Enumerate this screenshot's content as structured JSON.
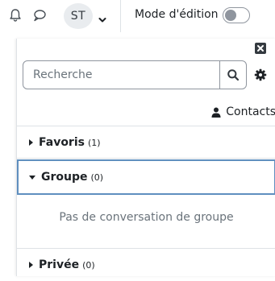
{
  "navbar": {
    "avatar_initials": "ST",
    "edit_mode_label": "Mode d'édition",
    "edit_mode_on": false,
    "icons": [
      "bell-icon",
      "chat-icon",
      "chevron-down-icon"
    ]
  },
  "drawer": {
    "search_placeholder": "Recherche",
    "contacts_label": "Contacts",
    "sections": [
      {
        "title": "Favoris",
        "count": "(1)",
        "expanded": false
      },
      {
        "title": "Groupe",
        "count": "(0)",
        "expanded": true,
        "empty_message": "Pas de conversation de groupe"
      },
      {
        "title": "Privée",
        "count": "(0)",
        "expanded": false
      }
    ]
  },
  "colors": {
    "text": "#1d2125",
    "muted": "#6a737b",
    "focus_border": "#5f8fbf",
    "avatar_bg": "#e9ecef"
  }
}
